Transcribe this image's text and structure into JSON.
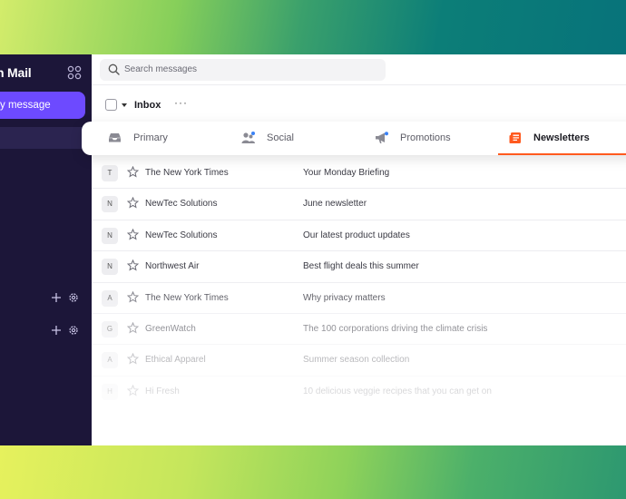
{
  "app": {
    "brand_text": "n Mail",
    "new_message_label": "y message"
  },
  "search": {
    "placeholder": "Search messages"
  },
  "toolbar": {
    "folder_label": "Inbox",
    "more_label": "···"
  },
  "tabs": [
    {
      "label": "Primary",
      "icon": "inbox-tray-icon",
      "active": false
    },
    {
      "label": "Social",
      "icon": "people-icon",
      "active": false
    },
    {
      "label": "Promotions",
      "icon": "megaphone-icon",
      "active": false
    },
    {
      "label": "Newsletters",
      "icon": "newspaper-icon",
      "active": true
    }
  ],
  "colors": {
    "sidebar_bg": "#1c1639",
    "accent": "#6d4aff",
    "active_tab_underline": "#ff5a1f",
    "notification_dot": "#3b82f6"
  },
  "messages": [
    {
      "initial": "T",
      "sender": "The New York Times",
      "subject": "Your Monday Briefing"
    },
    {
      "initial": "N",
      "sender": "NewTec Solutions",
      "subject": "June newsletter"
    },
    {
      "initial": "N",
      "sender": "NewTec Solutions",
      "subject": "Our latest product updates"
    },
    {
      "initial": "N",
      "sender": "Northwest Air",
      "subject": "Best flight deals this summer"
    },
    {
      "initial": "A",
      "sender": "The New York Times",
      "subject": "Why privacy matters"
    },
    {
      "initial": "G",
      "sender": "GreenWatch",
      "subject": "The 100 corporations driving the climate crisis"
    },
    {
      "initial": "A",
      "sender": "Ethical Apparel",
      "subject": "Summer season collection"
    },
    {
      "initial": "H",
      "sender": "Hi Fresh",
      "subject": "10 delicious veggie recipes that you can get on"
    }
  ]
}
